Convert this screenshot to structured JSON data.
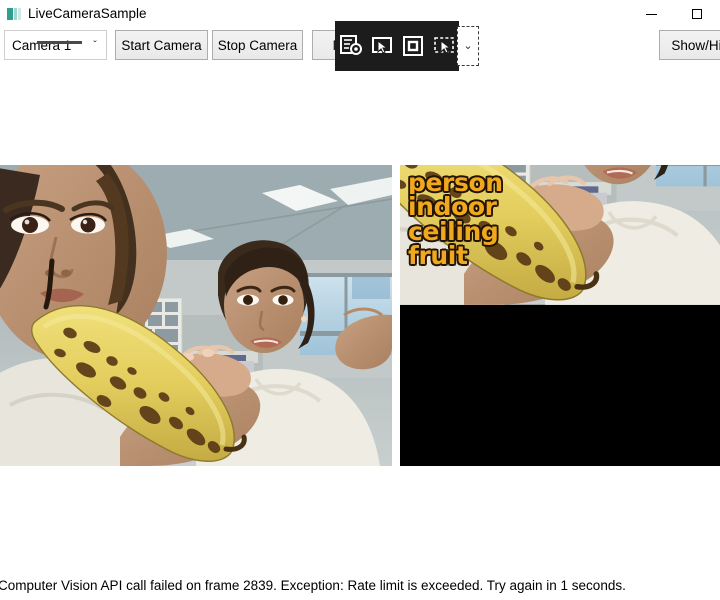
{
  "window": {
    "title": "LiveCameraSample",
    "icon": "app-icon",
    "controls": {
      "minimize": "minimize-button",
      "maximize": "maximize-button"
    }
  },
  "toolbar": {
    "camera_select": {
      "value": "Camera 1",
      "arrow": "ˇ"
    },
    "start_label": "Start Camera",
    "stop_label": "Stop Camera",
    "mode_label": "Mo",
    "showhide_label": "Show/Hi"
  },
  "capture_toolbar": {
    "icons": [
      "new-snip-icon",
      "rectangular-snip-icon",
      "window-snip-icon",
      "freeform-snip-icon"
    ],
    "chevron": "⌄"
  },
  "panes": {
    "left": {
      "name": "raw-camera-frame"
    },
    "right": {
      "name": "analyzed-camera-frame",
      "tags": [
        "person",
        "indoor",
        "ceiling",
        "fruit"
      ],
      "tag_color": "#f0a81e",
      "tag_outline_color": "#241402"
    }
  },
  "status": {
    "message": "Computer Vision API call failed on frame 2839. Exception: Rate limit is exceeded. Try again in 1 seconds."
  }
}
